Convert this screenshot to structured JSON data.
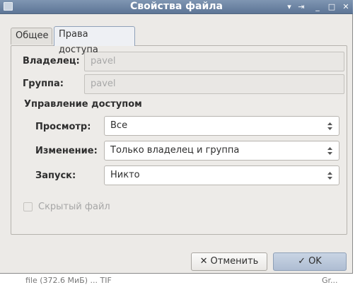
{
  "window": {
    "title": "Свойства файла"
  },
  "tabs": [
    {
      "label": "Общее"
    },
    {
      "label": "Права доступа"
    }
  ],
  "owner": {
    "label": "Владелец:",
    "value": "pavel"
  },
  "group": {
    "label": "Группа:",
    "value": "pavel"
  },
  "access": {
    "heading": "Управление доступом",
    "view": {
      "label": "Просмотр:",
      "value": "Все"
    },
    "edit": {
      "label": "Изменение:",
      "value": "Только владелец и группа"
    },
    "run": {
      "label": "Запуск:",
      "value": "Никто"
    }
  },
  "hidden_file": {
    "label": "Скрытый файл",
    "checked": false
  },
  "buttons": {
    "cancel": {
      "label": "Отменить",
      "icon": "close-icon"
    },
    "ok": {
      "label": "OK",
      "icon": "checkmark-icon"
    }
  },
  "background": {
    "fragment_left": "file (372.6 МиБ) ... TIF",
    "fragment_right": "Gr..."
  },
  "colors": {
    "titlebar": "#6b83a3",
    "dialog_bg": "#eceae7",
    "ok_button": "#b9c6d8"
  }
}
